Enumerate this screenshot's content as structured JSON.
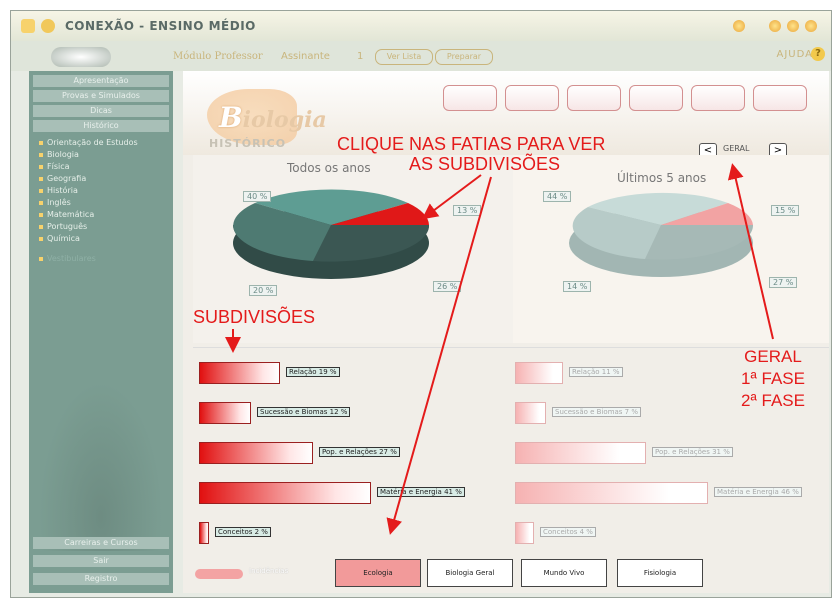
{
  "window": {
    "title": "CONEXÃO - ENSINO MÉDIO",
    "module_label": "Módulo Professor",
    "user_label": "Assinante",
    "user_number": "1",
    "pill_buttons": [
      "Ver Lista",
      "Preparar"
    ],
    "help_label": "AJUDA",
    "help_icon": "?"
  },
  "sidebar": {
    "top_buttons": [
      "Apresentação",
      "Provas e Simulados",
      "Dicas",
      "Histórico"
    ],
    "subjects": [
      "Orientação de Estudos",
      "Biologia",
      "Física",
      "Geografia",
      "História",
      "Inglês",
      "Matemática",
      "Português",
      "Química"
    ],
    "faded_item": "Vestibulares",
    "bottom_buttons": [
      "Carreiras e Cursos",
      "Sair",
      "Registro"
    ]
  },
  "header": {
    "subject_initial": "B",
    "subject_rest": "iologia",
    "section": "HISTÓRICO",
    "nav_prev": "<",
    "nav_label": "GERAL",
    "nav_next": ">"
  },
  "charts": {
    "left_title": "Todos os anos",
    "right_title": "Últimos 5 anos",
    "left_labels": [
      "40 %",
      "13 %",
      "20 %",
      "26 %"
    ],
    "right_labels": [
      "44 %",
      "15 %",
      "14 %",
      "27 %"
    ]
  },
  "chart_data": [
    {
      "type": "pie",
      "title": "Todos os anos",
      "slices": [
        {
          "label": "40 %",
          "value": 40,
          "color": "#5e9d93"
        },
        {
          "label": "13 %",
          "value": 13,
          "color": "#e01818"
        },
        {
          "label": "26 %",
          "value": 26,
          "color": "#3b5753"
        },
        {
          "label": "20 %",
          "value": 20,
          "color": "#4e7a72"
        }
      ]
    },
    {
      "type": "pie",
      "title": "Últimos 5 anos",
      "slices": [
        {
          "label": "44 %",
          "value": 44,
          "color": "#c7dbd8"
        },
        {
          "label": "15 %",
          "value": 15,
          "color": "#f2a3a3"
        },
        {
          "label": "27 %",
          "value": 27,
          "color": "#a6b9b6"
        },
        {
          "label": "14 %",
          "value": 14,
          "color": "#b7cbc8"
        }
      ]
    }
  ],
  "bars_left": [
    {
      "label": "Relação 19 %",
      "value": 19
    },
    {
      "label": "Sucessão e Biomas 12 %",
      "value": 12
    },
    {
      "label": "Pop. e Relações 27 %",
      "value": 27
    },
    {
      "label": "Matéria e Energia 41 %",
      "value": 41
    },
    {
      "label": "Conceitos 2 %",
      "value": 2
    }
  ],
  "bars_right": [
    {
      "label": "Relação 11 %",
      "value": 11
    },
    {
      "label": "Sucessão e Biomas 7 %",
      "value": 7
    },
    {
      "label": "Pop. e Relações 31 %",
      "value": 31
    },
    {
      "label": "Matéria e Energia 46 %",
      "value": 46
    },
    {
      "label": "Conceitos 4 %",
      "value": 4
    }
  ],
  "tabs": {
    "toggle_label": "Incidências",
    "items": [
      "Ecologia",
      "Biologia Geral",
      "Mundo Vivo",
      "Fisiologia"
    ]
  },
  "annotations": {
    "click_line1": "CLIQUE NAS FATIAS PARA VER",
    "click_line2": "AS SUBDIVISÕES",
    "subdivisoes": "SUBDIVISÕES",
    "geral": "GERAL",
    "fase1": "1ª FASE",
    "fase2": "2ª FASE"
  },
  "colors": {
    "accent_red": "#e41b1b",
    "sidebar": "#7b9d92",
    "tab_active": "#f29a9a"
  }
}
